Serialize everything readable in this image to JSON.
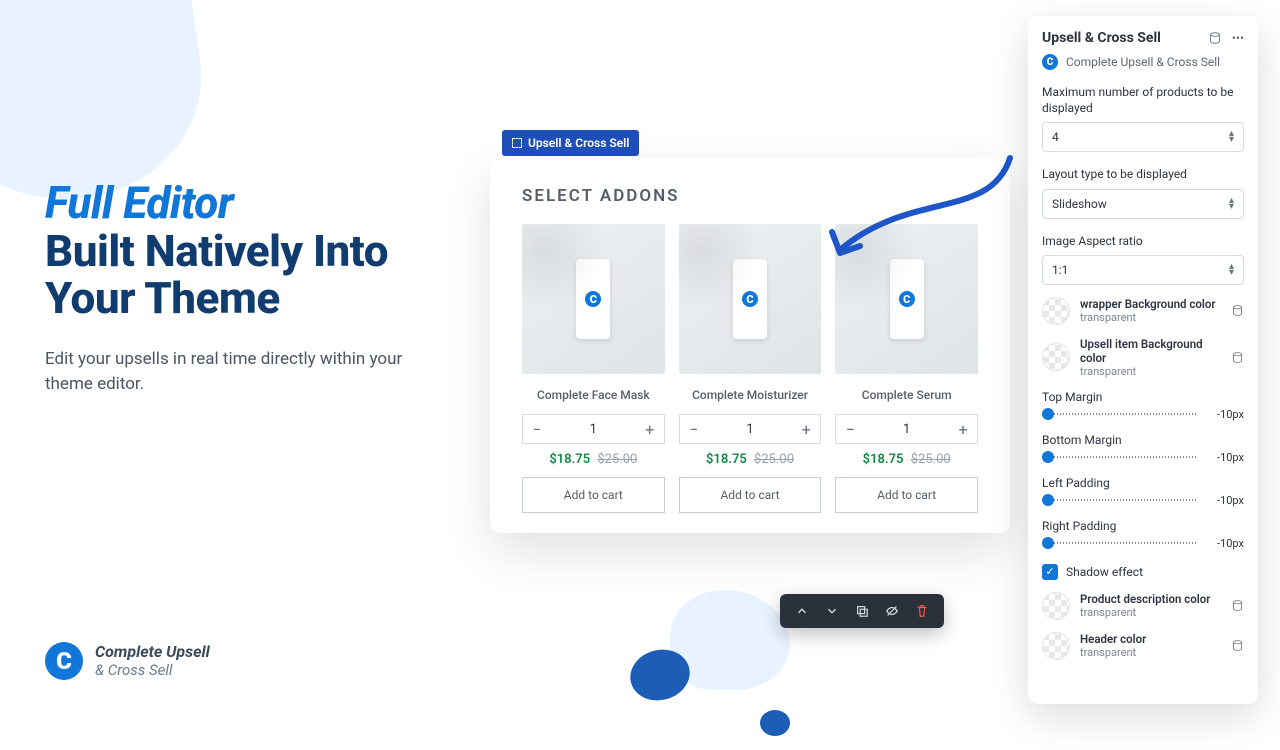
{
  "marketing": {
    "headline_accent": "Full Editor",
    "headline_rest": "Built Natively Into Your Theme",
    "subhead": "Edit your upsells in real time directly within your theme editor."
  },
  "brand": {
    "line1": "Complete Upsell",
    "line2": "& Cross Sell"
  },
  "preview": {
    "tag": "Upsell & Cross Sell",
    "heading": "SELECT ADDONS",
    "products": [
      {
        "name": "Complete Face Mask",
        "qty": "1",
        "sale": "$18.75",
        "orig": "$25.00",
        "cta": "Add to cart"
      },
      {
        "name": "Complete Moisturizer",
        "qty": "1",
        "sale": "$18.75",
        "orig": "$25.00",
        "cta": "Add to cart"
      },
      {
        "name": "Complete Serum",
        "qty": "1",
        "sale": "$18.75",
        "orig": "$25.00",
        "cta": "Add to cart"
      }
    ]
  },
  "panel": {
    "title": "Upsell & Cross Sell",
    "app_name": "Complete Upsell & Cross Sell",
    "max_label": "Maximum number of products to be displayed",
    "max_value": "4",
    "layout_label": "Layout type to be displayed",
    "layout_value": "Slideshow",
    "aspect_label": "Image Aspect ratio",
    "aspect_value": "1:1",
    "color_rows": [
      {
        "title": "wrapper Background color",
        "value": "transparent"
      },
      {
        "title": "Upsell item Background color",
        "value": "transparent"
      }
    ],
    "sliders": [
      {
        "label": "Top Margin",
        "value": "-10px"
      },
      {
        "label": "Bottom Margin",
        "value": "-10px"
      },
      {
        "label": "Left Padding",
        "value": "-10px"
      },
      {
        "label": "Right Padding",
        "value": "-10px"
      }
    ],
    "shadow_label": "Shadow effect",
    "footer_rows": [
      {
        "title": "Product description color",
        "value": "transparent"
      },
      {
        "title": "Header color",
        "value": "transparent"
      }
    ]
  }
}
